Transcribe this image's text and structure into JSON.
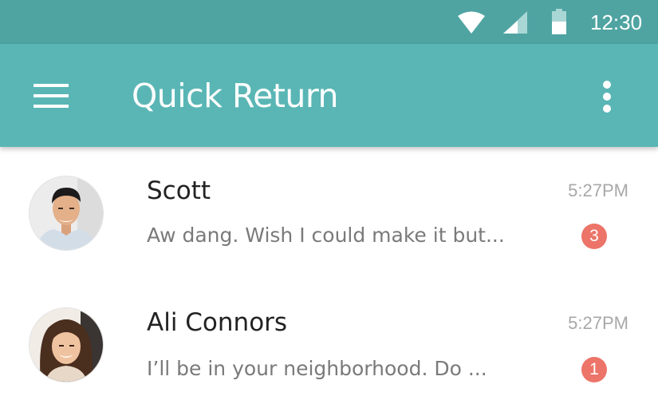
{
  "status_bar": {
    "time": "12:30",
    "icons": [
      "wifi-icon",
      "cell-signal-icon",
      "battery-icon"
    ]
  },
  "app_bar": {
    "title": "Quick Return",
    "color": "#5ab6b5",
    "status_color": "#4fa4a2",
    "menu_icon": "menu-icon",
    "overflow_icon": "more-vert-icon"
  },
  "conversations": [
    {
      "name": "Scott",
      "time": "5:27PM",
      "snippet": "Aw dang. Wish I could make it but...",
      "unread": "3",
      "avatar_icon": "avatar-photo-icon"
    },
    {
      "name": "Ali Connors",
      "time": "5:27PM",
      "snippet": "I’ll be in your neighborhood. Do ...",
      "unread": "1",
      "avatar_icon": "avatar-photo-icon"
    }
  ],
  "badge_color": "#ec7468"
}
